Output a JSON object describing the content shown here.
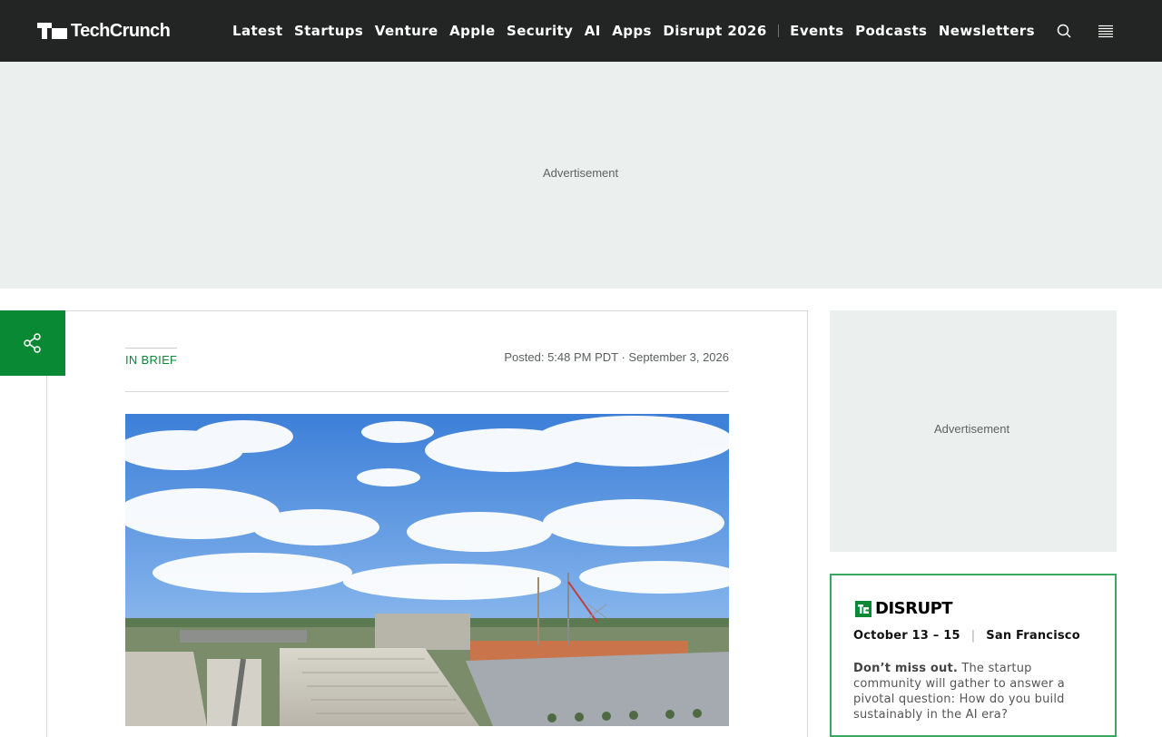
{
  "header": {
    "brand": "TechCrunch",
    "nav": [
      "Latest",
      "Startups",
      "Venture",
      "Apple",
      "Security",
      "AI",
      "Apps",
      "Disrupt 2026"
    ],
    "nav_secondary": [
      "Events",
      "Podcasts",
      "Newsletters"
    ]
  },
  "ads": {
    "banner_label": "Advertisement",
    "sidebar_label": "Advertisement"
  },
  "article": {
    "category": "IN BRIEF",
    "posted": "Posted: 5:48 PM PDT · September 3, 2026"
  },
  "promo": {
    "brand": "DISRUPT",
    "dates": "October 13 – 15",
    "location": "San Francisco",
    "lead": "Don’t miss out.",
    "body": " The startup community will gather to answer a pivotal question: How do you build sustainably in the AI era?"
  },
  "colors": {
    "header_bg": "#222523",
    "accent_green": "#0a8935",
    "ad_bg": "#ebefee",
    "promo_border": "#3aa85e"
  }
}
